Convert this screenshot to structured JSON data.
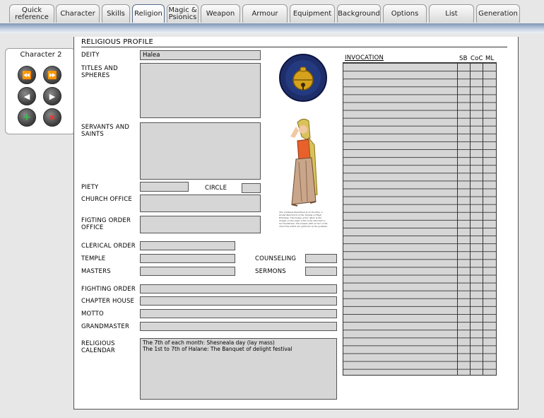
{
  "tabs": [
    {
      "label": "Quick reference"
    },
    {
      "label": "Character"
    },
    {
      "label": "Skills"
    },
    {
      "label": "Religion",
      "active": true
    },
    {
      "label": "Magic & Psionics"
    },
    {
      "label": "Weapon"
    },
    {
      "label": "Armour"
    },
    {
      "label": "Equipment"
    },
    {
      "label": "Background"
    },
    {
      "label": "Options"
    },
    {
      "label": "List"
    },
    {
      "label": "Generation"
    }
  ],
  "character_panel": {
    "name": "Character 2"
  },
  "sheet": {
    "title": "RELIGIOUS PROFILE",
    "deity_label": "DEITY",
    "deity_value": "Halea",
    "titles_label": "TITLES AND SPHERES",
    "servants_label": "SERVANTS AND SAINTS",
    "piety_label": "PIETY",
    "circle_label": "CIRCLE",
    "church_office_label": "CHURCH OFFICE",
    "fighting_order_office_label": "FIGTING ORDER OFFICE",
    "clerical_order_label": "CLERICAL ORDER",
    "temple_label": "TEMPLE",
    "counseling_label": "COUNSELING",
    "masters_label": "MASTERS",
    "sermons_label": "SERMONS",
    "fighting_order_label": "FIGHTING ORDER",
    "chapter_house_label": "CHAPTER HOUSE",
    "motto_label": "MOTTO",
    "grandmaster_label": "GRANDMASTER",
    "calendar_label": "RELIGIOUS CALENDAR",
    "calendar_lines": [
      "The 7th of each month: Shesneala day (lay mass)",
      "The 1st to 7th of Halane: The Banquet of delight festival"
    ],
    "image_caption": "The priestess illustrated is an Ilvarine, a Grand Matriarch of the Temple of High Priestess. The badge of her office is the dangle on the edge of the bone attached to her headdress. The tassels with an her cords and arms which are symbolic of the goddess.",
    "invocation_header": "INVOCATION",
    "sb_header": "SB",
    "coc_header": "CoC",
    "ml_header": "ML"
  },
  "colors": {
    "field_fill": "#d6d6d6",
    "band_top": "#7e95b5",
    "sheet_bg": "#ffffff"
  }
}
